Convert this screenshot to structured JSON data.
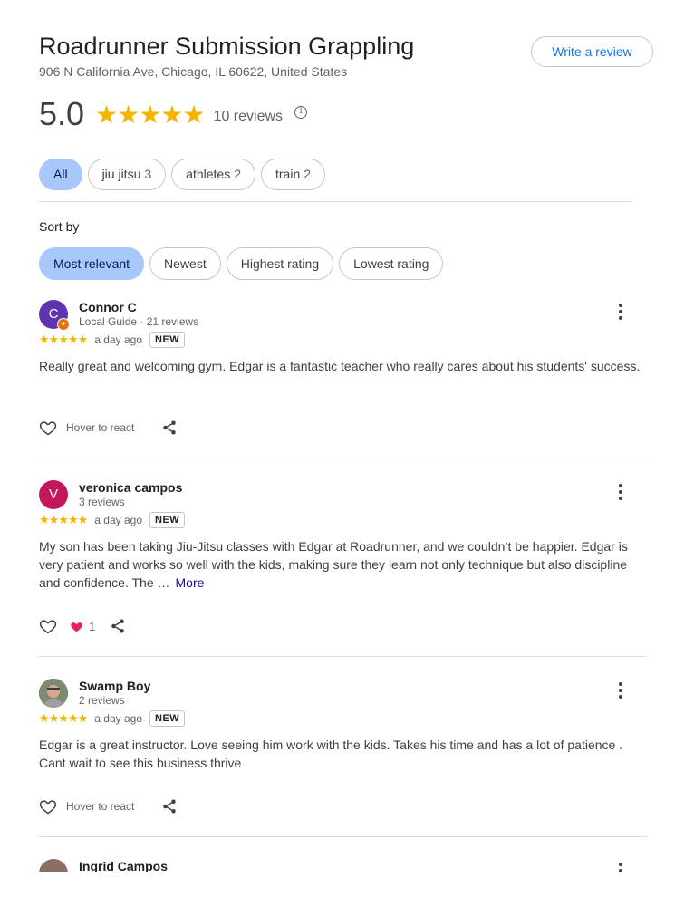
{
  "header": {
    "title": "Roadrunner Submission Grappling",
    "address": "906 N California Ave, Chicago, IL 60622, United States",
    "write_review": "Write a review"
  },
  "summary": {
    "rating": "5.0",
    "stars": "★★★★★",
    "count_label": "10 reviews"
  },
  "topics": [
    {
      "label": "All",
      "count": ""
    },
    {
      "label": "jiu jitsu",
      "count": "3"
    },
    {
      "label": "athletes",
      "count": "2"
    },
    {
      "label": "train",
      "count": "2"
    }
  ],
  "sort": {
    "label": "Sort by",
    "options": [
      "Most relevant",
      "Newest",
      "Highest rating",
      "Lowest rating"
    ]
  },
  "reviews": [
    {
      "initial": "C",
      "name": "Connor C",
      "sub": "Local Guide · 21 reviews",
      "stars": "★★★★★",
      "date": "a day ago",
      "tag": "NEW",
      "text": "Really great and welcoming gym. Edgar is a fantastic teacher who really cares about his students' success.",
      "react": "Hover to react",
      "avatar_color": "#5e35b1"
    },
    {
      "initial": "V",
      "name": "veronica campos",
      "sub": "3 reviews",
      "stars": "★★★★★",
      "date": "a day ago",
      "tag": "NEW",
      "text": "My son has been taking Jiu-Jitsu classes with Edgar at Roadrunner, and we couldn’t be happier. Edgar is very patient and works so well with the kids, making sure they learn not only technique but also discipline and confidence. The …",
      "more": "More",
      "likes": "1",
      "avatar_color": "#c2185b"
    },
    {
      "initial": "",
      "name": "Swamp Boy",
      "sub": "2 reviews",
      "stars": "★★★★★",
      "date": "a day ago",
      "tag": "NEW",
      "text": "Edgar is a great instructor. Love seeing him work with the kids. Takes his time and has a lot of patience . Cant wait to see this business thrive",
      "react": "Hover to react",
      "avatar_color": "#6d7a63"
    },
    {
      "name": "Ingrid Campos",
      "avatar_color": "#8d6e63"
    }
  ]
}
